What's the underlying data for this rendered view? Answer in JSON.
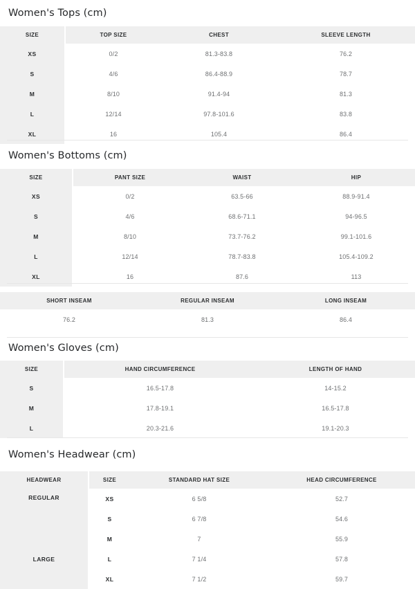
{
  "page": {
    "background": "#ffffff",
    "header_bg": "#efefef",
    "header_text_color": "#2c2e30",
    "body_text_color": "#6e7072",
    "rule_color": "#e6e6e6"
  },
  "sections": {
    "tops": {
      "title": "Women's Tops (cm)",
      "columns": [
        "SIZE",
        "TOP SIZE",
        "CHEST",
        "SLEEVE LENGTH"
      ],
      "rows": [
        [
          "XS",
          "0/2",
          "81.3-83.8",
          "76.2"
        ],
        [
          "S",
          "4/6",
          "86.4-88.9",
          "78.7"
        ],
        [
          "M",
          "8/10",
          "91.4-94",
          "81.3"
        ],
        [
          "L",
          "12/14",
          "97.8-101.6",
          "83.8"
        ],
        [
          "XL",
          "16",
          "105.4",
          "86.4"
        ]
      ]
    },
    "bottoms": {
      "title": "Women's Bottoms (cm)",
      "columns": [
        "SIZE",
        "PANT SIZE",
        "WAIST",
        "HIP"
      ],
      "rows": [
        [
          "XS",
          "0/2",
          "63.5-66",
          "88.9-91.4"
        ],
        [
          "S",
          "4/6",
          "68.6-71.1",
          "94-96.5"
        ],
        [
          "M",
          "8/10",
          "73.7-76.2",
          "99.1-101.6"
        ],
        [
          "L",
          "12/14",
          "78.7-83.8",
          "105.4-109.2"
        ],
        [
          "XL",
          "16",
          "87.6",
          "113"
        ]
      ]
    },
    "inseam": {
      "title": "",
      "columns": [
        "SHORT INSEAM",
        "REGULAR INSEAM",
        "LONG INSEAM"
      ],
      "rows": [
        [
          "76.2",
          "81.3",
          "86.4"
        ]
      ]
    },
    "gloves": {
      "title": "Women's Gloves (cm)",
      "columns": [
        "SIZE",
        "HAND CIRCUMFERENCE",
        "LENGTH OF HAND"
      ],
      "rows": [
        [
          "S",
          "16.5-17.8",
          "14-15.2"
        ],
        [
          "M",
          "17.8-19.1",
          "16.5-17.8"
        ],
        [
          "L",
          "20.3-21.6",
          "19.1-20.3"
        ]
      ]
    },
    "headwear": {
      "title": "Women's Headwear (cm)",
      "columns": [
        "HEADWEAR",
        "SIZE",
        "STANDARD HAT SIZE",
        "HEAD CIRCUMFERENCE"
      ],
      "groups": [
        {
          "label": "REGULAR",
          "span": 2
        },
        {
          "label": "LARGE",
          "span": 3
        }
      ],
      "rows": [
        [
          "XS",
          "6 5/8",
          "52.7"
        ],
        [
          "S",
          "6 7/8",
          "54.6"
        ],
        [
          "M",
          "7",
          "55.9"
        ],
        [
          "L",
          "7 1/4",
          "57.8"
        ],
        [
          "XL",
          "7 1/2",
          "59.7"
        ]
      ]
    }
  }
}
